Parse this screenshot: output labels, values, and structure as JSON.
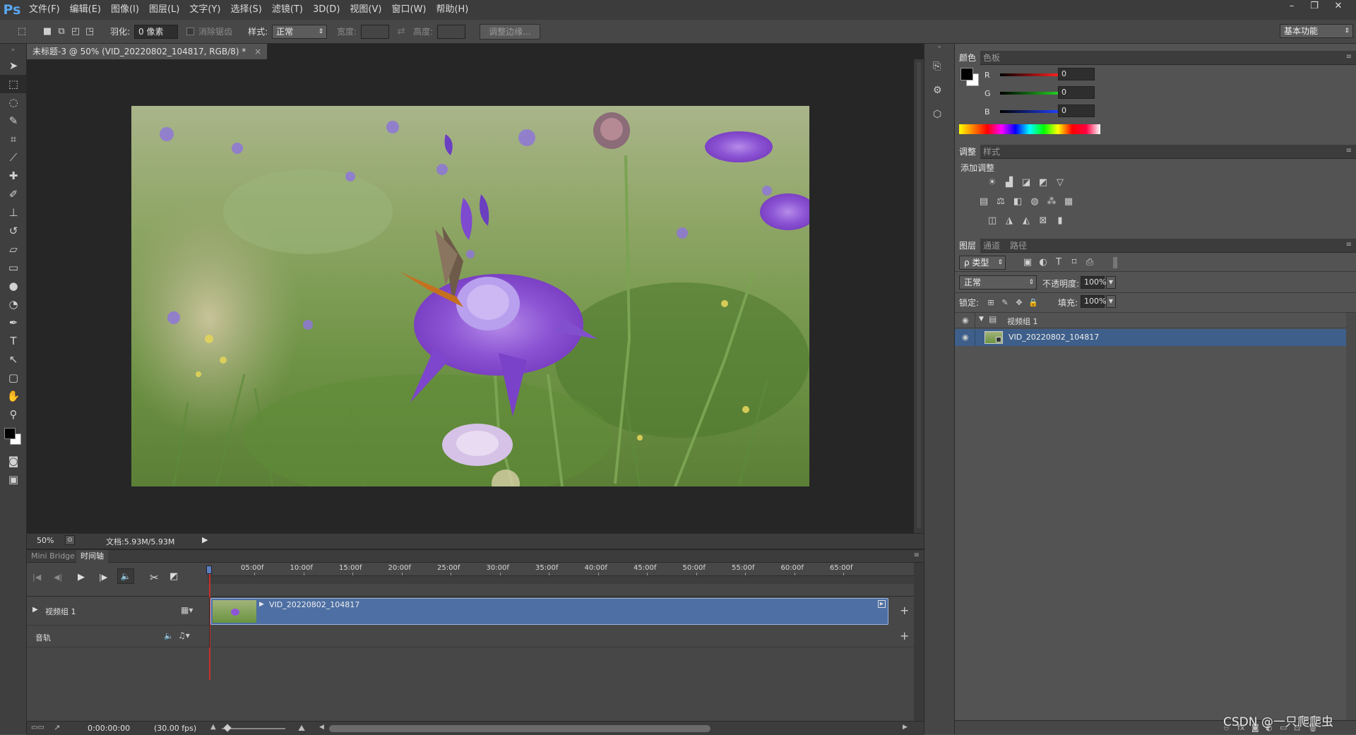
{
  "app": {
    "logo": "Ps"
  },
  "menubar": {
    "items": [
      "文件(F)",
      "编辑(E)",
      "图像(I)",
      "图层(L)",
      "文字(Y)",
      "选择(S)",
      "滤镜(T)",
      "3D(D)",
      "视图(V)",
      "窗口(W)",
      "帮助(H)"
    ],
    "window_controls": [
      "–",
      "❐",
      "✕"
    ]
  },
  "options": {
    "feather_label": "羽化:",
    "feather_value": "0 像素",
    "antialias_label": "消除锯齿",
    "style_label": "样式:",
    "style_value": "正常",
    "width_label": "宽度:",
    "height_label": "高度:",
    "refine_edge_button": "调整边缘...",
    "workspace_value": "基本功能"
  },
  "document": {
    "tab_title": "未标题-3 @ 50% (VID_20220802_104817, RGB/8) *",
    "tab_close": "×",
    "zoom": "50%",
    "doc_size": "文档:5.93M/5.93M"
  },
  "timeline": {
    "tabs": [
      "Mini Bridge",
      "时间轴"
    ],
    "ruler_labels": [
      "05:00f",
      "10:00f",
      "15:00f",
      "20:00f",
      "25:00f",
      "30:00f",
      "35:00f",
      "40:00f",
      "45:00f",
      "50:00f",
      "55:00f",
      "60:00f",
      "65:00f"
    ],
    "video_group_label": "视频组 1",
    "clip_name": "VID_20220802_104817",
    "audio_label": "音轨",
    "timecode": "0:00:00:00",
    "fps": "(30.00 fps)"
  },
  "color_panel": {
    "tabs": [
      "颜色",
      "色板"
    ],
    "channels": [
      {
        "label": "R",
        "value": "0",
        "color": "#ff2020"
      },
      {
        "label": "G",
        "value": "0",
        "color": "#20d020"
      },
      {
        "label": "B",
        "value": "0",
        "color": "#2040ff"
      }
    ]
  },
  "adjustments_panel": {
    "tabs": [
      "调整",
      "样式"
    ],
    "add_label": "添加调整"
  },
  "layers_panel": {
    "tabs": [
      "图层",
      "通道",
      "路径"
    ],
    "filter_label": "ρ 类型",
    "blend_mode": "正常",
    "opacity_label": "不透明度:",
    "opacity_value": "100%",
    "lock_label": "锁定:",
    "fill_label": "填充:",
    "fill_value": "100%",
    "group_name": "视频组 1",
    "layer_name": "VID_20220802_104817"
  },
  "watermark": "CSDN @一只爬爬虫",
  "colors": {
    "selection_blue": "#3e5f8a",
    "clip_blue": "#4d6fa3",
    "playhead_red": "#c8302a"
  }
}
